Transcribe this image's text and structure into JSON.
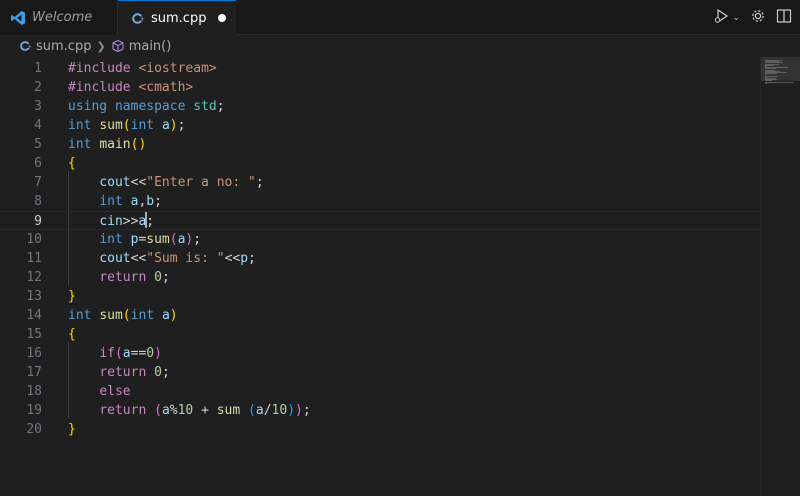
{
  "tabs": [
    {
      "label": "Welcome",
      "icon": "vscode-logo-icon"
    },
    {
      "label": "sum.cpp",
      "icon": "cpp-file-icon",
      "dirty": true
    }
  ],
  "breadcrumb": {
    "file": "sum.cpp",
    "symbol": "main()"
  },
  "editor": {
    "active_line": 9,
    "line_numbers": [
      "1",
      "2",
      "3",
      "4",
      "5",
      "6",
      "7",
      "8",
      "9",
      "10",
      "11",
      "12",
      "13",
      "14",
      "15",
      "16",
      "17",
      "18",
      "19",
      "20"
    ],
    "lines": [
      [
        [
          "pp",
          "#include "
        ],
        [
          "inc",
          "<iostream>"
        ]
      ],
      [
        [
          "pp",
          "#include "
        ],
        [
          "inc",
          "<cmath>"
        ]
      ],
      [
        [
          "k",
          "using"
        ],
        [
          "p",
          " "
        ],
        [
          "k",
          "namespace"
        ],
        [
          "p",
          " "
        ],
        [
          "t",
          "std"
        ],
        [
          "p",
          ";"
        ]
      ],
      [
        [
          "k",
          "int"
        ],
        [
          "p",
          " "
        ],
        [
          "f",
          "sum"
        ],
        [
          "b1",
          "("
        ],
        [
          "k",
          "int"
        ],
        [
          "p",
          " "
        ],
        [
          "v",
          "a"
        ],
        [
          "b1",
          ")"
        ],
        [
          "p",
          ";"
        ]
      ],
      [
        [
          "k",
          "int"
        ],
        [
          "p",
          " "
        ],
        [
          "f",
          "main"
        ],
        [
          "b1",
          "()"
        ]
      ],
      [
        [
          "b1",
          "{"
        ]
      ],
      [
        [
          "p",
          "    "
        ],
        [
          "v",
          "cout"
        ],
        [
          "p",
          "<<"
        ],
        [
          "s",
          "\"Enter a no: \""
        ],
        [
          "p",
          ";"
        ]
      ],
      [
        [
          "p",
          "    "
        ],
        [
          "k",
          "int"
        ],
        [
          "p",
          " "
        ],
        [
          "v",
          "a"
        ],
        [
          "p",
          ","
        ],
        [
          "v",
          "b"
        ],
        [
          "p",
          ";"
        ]
      ],
      [
        [
          "p",
          "    "
        ],
        [
          "v",
          "cin"
        ],
        [
          "p",
          ">>"
        ],
        [
          "v",
          "a"
        ],
        [
          "cursor",
          ""
        ],
        [
          "p",
          ";"
        ]
      ],
      [
        [
          "p",
          "    "
        ],
        [
          "k",
          "int"
        ],
        [
          "p",
          " "
        ],
        [
          "v",
          "p"
        ],
        [
          "p",
          "="
        ],
        [
          "f",
          "sum"
        ],
        [
          "b2",
          "("
        ],
        [
          "v",
          "a"
        ],
        [
          "b2",
          ")"
        ],
        [
          "p",
          ";"
        ]
      ],
      [
        [
          "p",
          "    "
        ],
        [
          "v",
          "cout"
        ],
        [
          "p",
          "<<"
        ],
        [
          "s",
          "\"Sum is: \""
        ],
        [
          "p",
          "<<"
        ],
        [
          "v",
          "p"
        ],
        [
          "p",
          ";"
        ]
      ],
      [
        [
          "p",
          "    "
        ],
        [
          "ctl",
          "return"
        ],
        [
          "p",
          " "
        ],
        [
          "n",
          "0"
        ],
        [
          "p",
          ";"
        ]
      ],
      [
        [
          "b1",
          "}"
        ]
      ],
      [
        [
          "k",
          "int"
        ],
        [
          "p",
          " "
        ],
        [
          "f",
          "sum"
        ],
        [
          "b1",
          "("
        ],
        [
          "k",
          "int"
        ],
        [
          "p",
          " "
        ],
        [
          "v",
          "a"
        ],
        [
          "b1",
          ")"
        ]
      ],
      [
        [
          "b1",
          "{"
        ]
      ],
      [
        [
          "p",
          "    "
        ],
        [
          "ctl",
          "if"
        ],
        [
          "b2",
          "("
        ],
        [
          "v",
          "a"
        ],
        [
          "p",
          "=="
        ],
        [
          "n",
          "0"
        ],
        [
          "b2",
          ")"
        ]
      ],
      [
        [
          "p",
          "    "
        ],
        [
          "ctl",
          "return"
        ],
        [
          "p",
          " "
        ],
        [
          "n",
          "0"
        ],
        [
          "p",
          ";"
        ]
      ],
      [
        [
          "p",
          "    "
        ],
        [
          "ctl",
          "else"
        ]
      ],
      [
        [
          "p",
          "    "
        ],
        [
          "ctl",
          "return"
        ],
        [
          "p",
          " "
        ],
        [
          "b2",
          "("
        ],
        [
          "v",
          "a"
        ],
        [
          "p",
          "%"
        ],
        [
          "n",
          "10"
        ],
        [
          "p",
          " + "
        ],
        [
          "f",
          "sum"
        ],
        [
          "p",
          " "
        ],
        [
          "b3",
          "("
        ],
        [
          "v",
          "a"
        ],
        [
          "p",
          "/"
        ],
        [
          "n",
          "10"
        ],
        [
          "b3",
          ")"
        ],
        [
          "b2",
          ")"
        ],
        [
          "p",
          ";"
        ]
      ],
      [
        [
          "b1",
          "}"
        ]
      ]
    ]
  },
  "colors": {
    "accent": "#0078d4",
    "editor_bg": "#1f1f1f",
    "tabbar_bg": "#181818"
  }
}
